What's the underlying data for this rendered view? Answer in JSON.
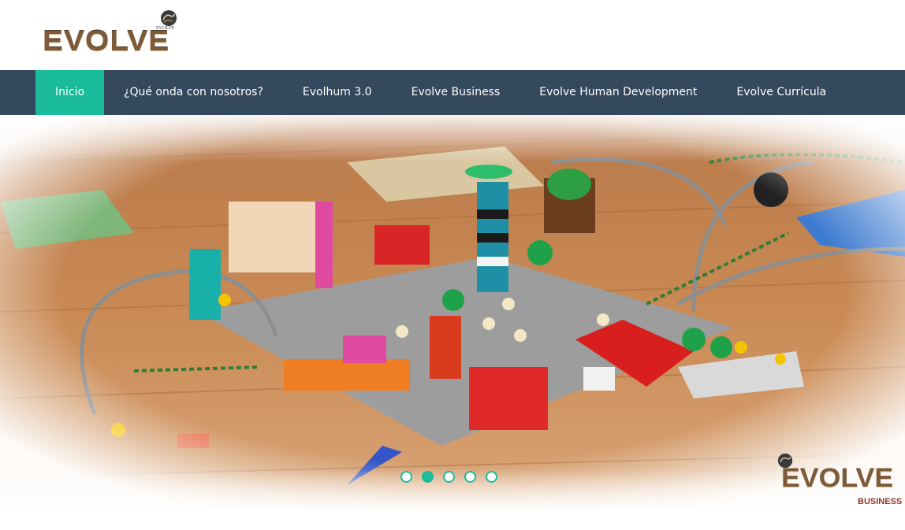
{
  "brand": {
    "logo_text": "EVOLVE",
    "logo_small": "EVOLVE"
  },
  "nav": {
    "items": [
      {
        "label": "Inicio",
        "active": true
      },
      {
        "label": "¿Qué onda con nosotros?",
        "active": false
      },
      {
        "label": "Evolhum 3.0",
        "active": false
      },
      {
        "label": "Evolve Business",
        "active": false
      },
      {
        "label": "Evolve Human Development",
        "active": false
      },
      {
        "label": "Evolve Currícula",
        "active": false
      }
    ]
  },
  "slider": {
    "slide_count": 5,
    "active_slide": 2,
    "badge_text": "EVOLVE",
    "badge_sub": "BUSINESS"
  },
  "colors": {
    "nav_bg": "#34495e",
    "nav_active": "#1abc9c",
    "brand_brown": "#7d5b3a"
  },
  "icons": {
    "logo_emblem": "globe-emblem-icon"
  }
}
